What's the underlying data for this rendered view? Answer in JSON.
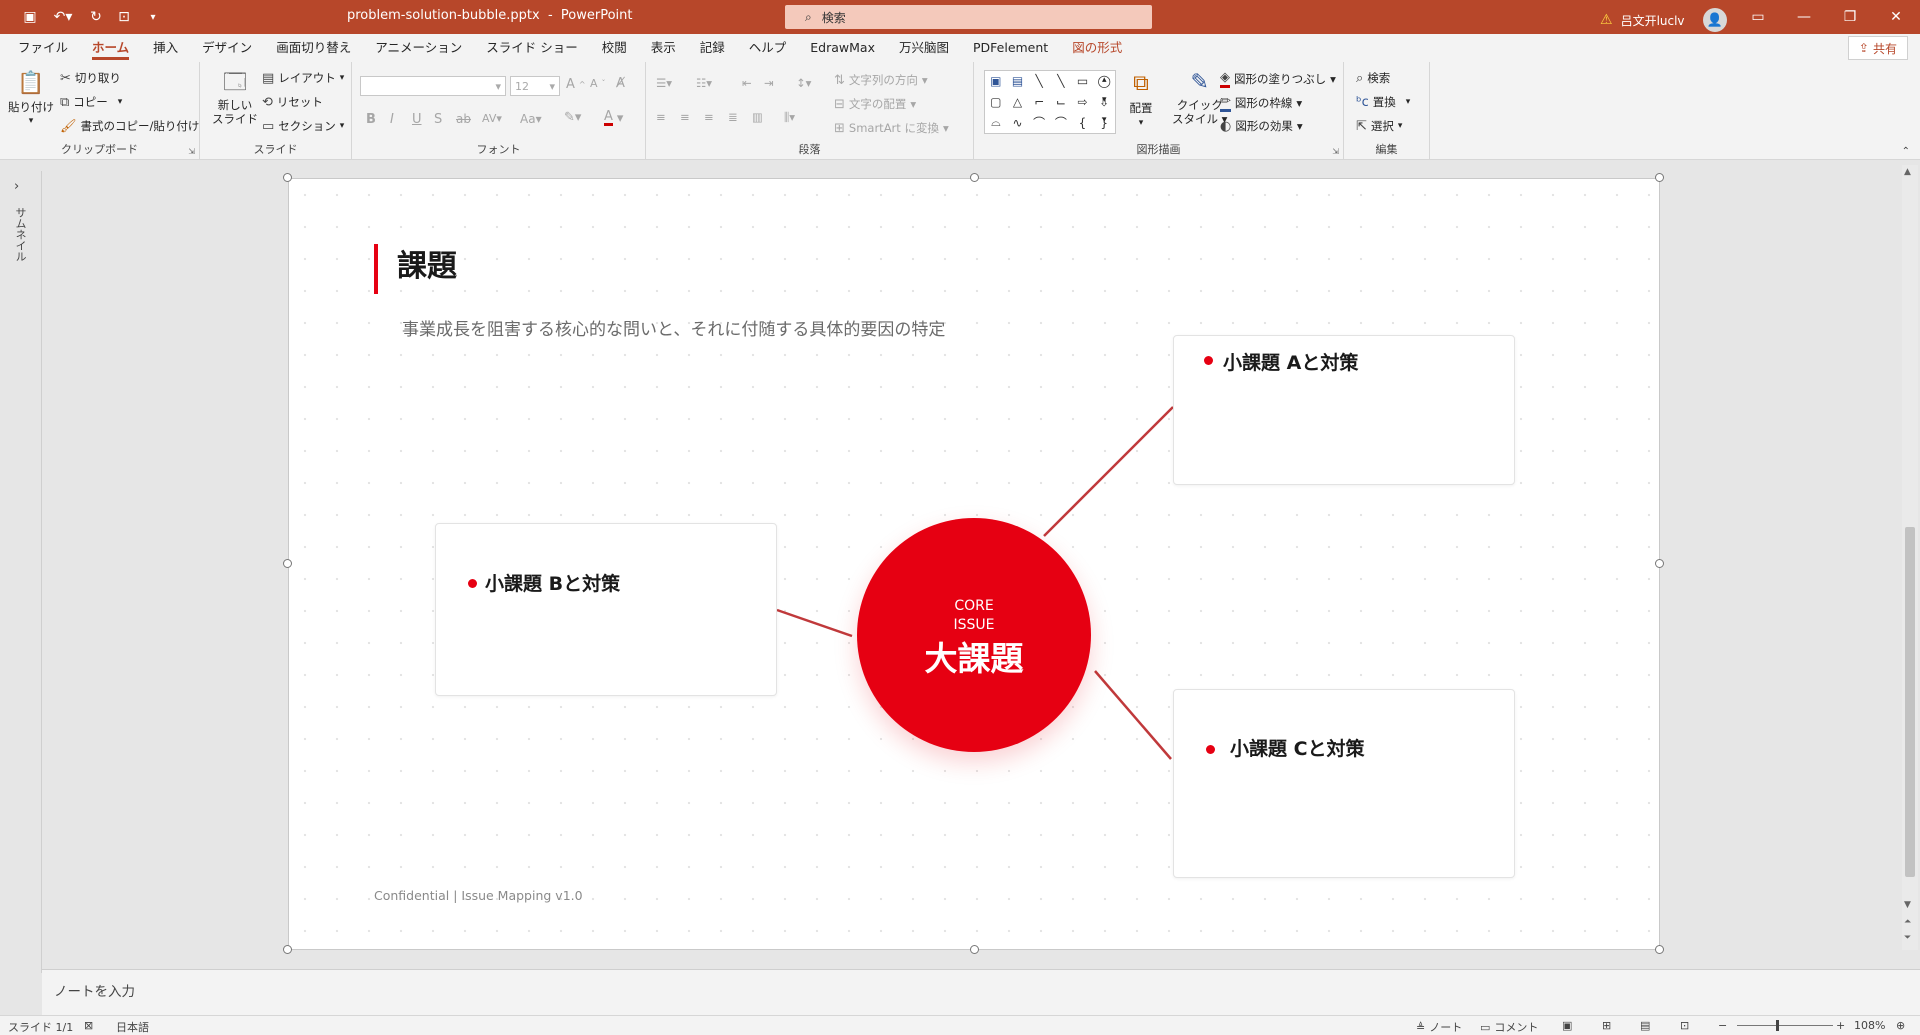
{
  "window": {
    "filename": "problem-solution-bubble.pptx",
    "app": "PowerPoint",
    "search_placeholder": "検索",
    "user_name": "吕文开luclv"
  },
  "ribbon_tabs": [
    "ファイル",
    "ホーム",
    "挿入",
    "デザイン",
    "画面切り替え",
    "アニメーション",
    "スライド ショー",
    "校閲",
    "表示",
    "記録",
    "ヘルプ",
    "EdrawMax",
    "万兴脑图",
    "PDFelement",
    "図の形式"
  ],
  "share_label": "共有",
  "ribbon": {
    "clipboard": {
      "label": "クリップボード",
      "paste": "貼り付け",
      "cut": "切り取り",
      "copy": "コピー",
      "format_painter": "書式のコピー/貼り付け"
    },
    "slides": {
      "label": "スライド",
      "new_slide_1": "新しい",
      "new_slide_2": "スライド",
      "layout": "レイアウト",
      "reset": "リセット",
      "section": "セクション"
    },
    "font": {
      "label": "フォント",
      "size": "12"
    },
    "paragraph": {
      "label": "段落",
      "text_direction": "文字列の方向",
      "align_text": "文字の配置",
      "smartart": "SmartArt に変換"
    },
    "drawing": {
      "label": "図形描画",
      "arrange": "配置",
      "quick_style_1": "クイック",
      "quick_style_2": "スタイル",
      "fill": "図形の塗りつぶし",
      "outline": "図形の枠線",
      "effects": "図形の効果"
    },
    "editing": {
      "label": "編集",
      "find": "検索",
      "replace": "置換",
      "select": "選択"
    }
  },
  "sidebar_label": "サムネイル",
  "slide": {
    "title": "課題",
    "subtitle": "事業成長を阻害する核心的な問いと、それに付随する具体的要因の特定",
    "core_en_1": "CORE",
    "core_en_2": "ISSUE",
    "core_jp": "大課題",
    "card_a": "小課題 Aと対策",
    "card_b": "小課題 Bと対策",
    "card_c": "小課題 Cと対策",
    "footer": "Confidential | Issue Mapping v1.0",
    "accent_color": "#e60012"
  },
  "notes_placeholder": "ノートを入力",
  "status": {
    "slide_indicator": "スライド 1/1",
    "language": "日本語",
    "notes": "ノート",
    "comments": "コメント",
    "zoom": "108%"
  }
}
